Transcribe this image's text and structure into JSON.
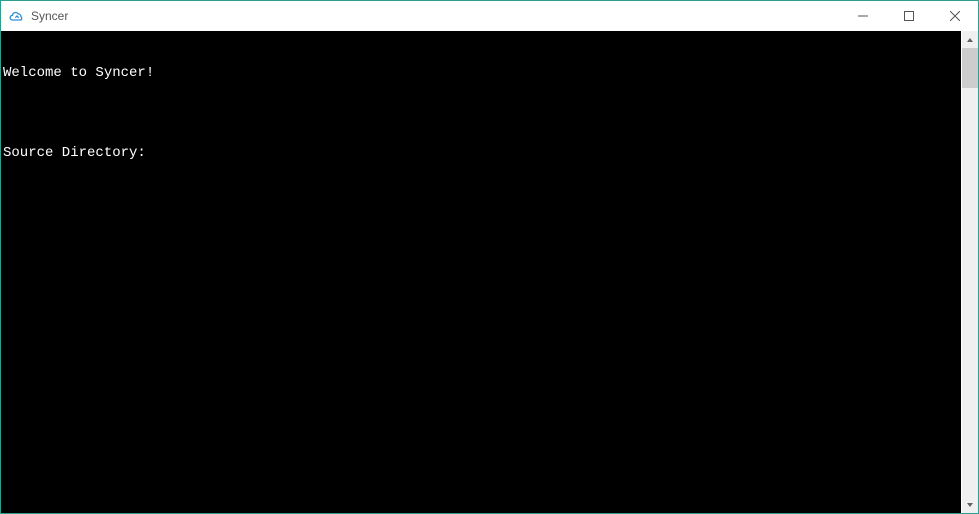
{
  "window": {
    "title": "Syncer",
    "icon_name": "cloud-sync-icon",
    "icon_color": "#2f8fd6"
  },
  "console": {
    "lines": [
      "Welcome to Syncer!",
      "",
      "Source Directory:"
    ]
  }
}
